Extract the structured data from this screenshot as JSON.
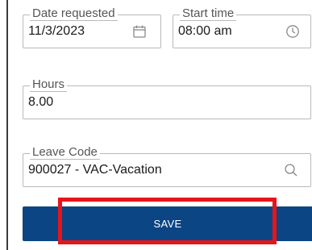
{
  "form": {
    "date_requested": {
      "label": "Date requested",
      "value": "11/3/2023",
      "icon": "calendar-icon"
    },
    "start_time": {
      "label": "Start time",
      "value": "08:00 am",
      "icon": "clock-icon"
    },
    "hours": {
      "label": "Hours",
      "value": "8.00"
    },
    "leave_code": {
      "label": "Leave Code",
      "value": "900027 - VAC-Vacation",
      "icon": "search-icon"
    }
  },
  "actions": {
    "save_label": "SAVE"
  },
  "colors": {
    "primary": "#0b4583",
    "highlight": "#e8141b",
    "border": "#b9b9b9",
    "icon": "#8a8a8a"
  }
}
